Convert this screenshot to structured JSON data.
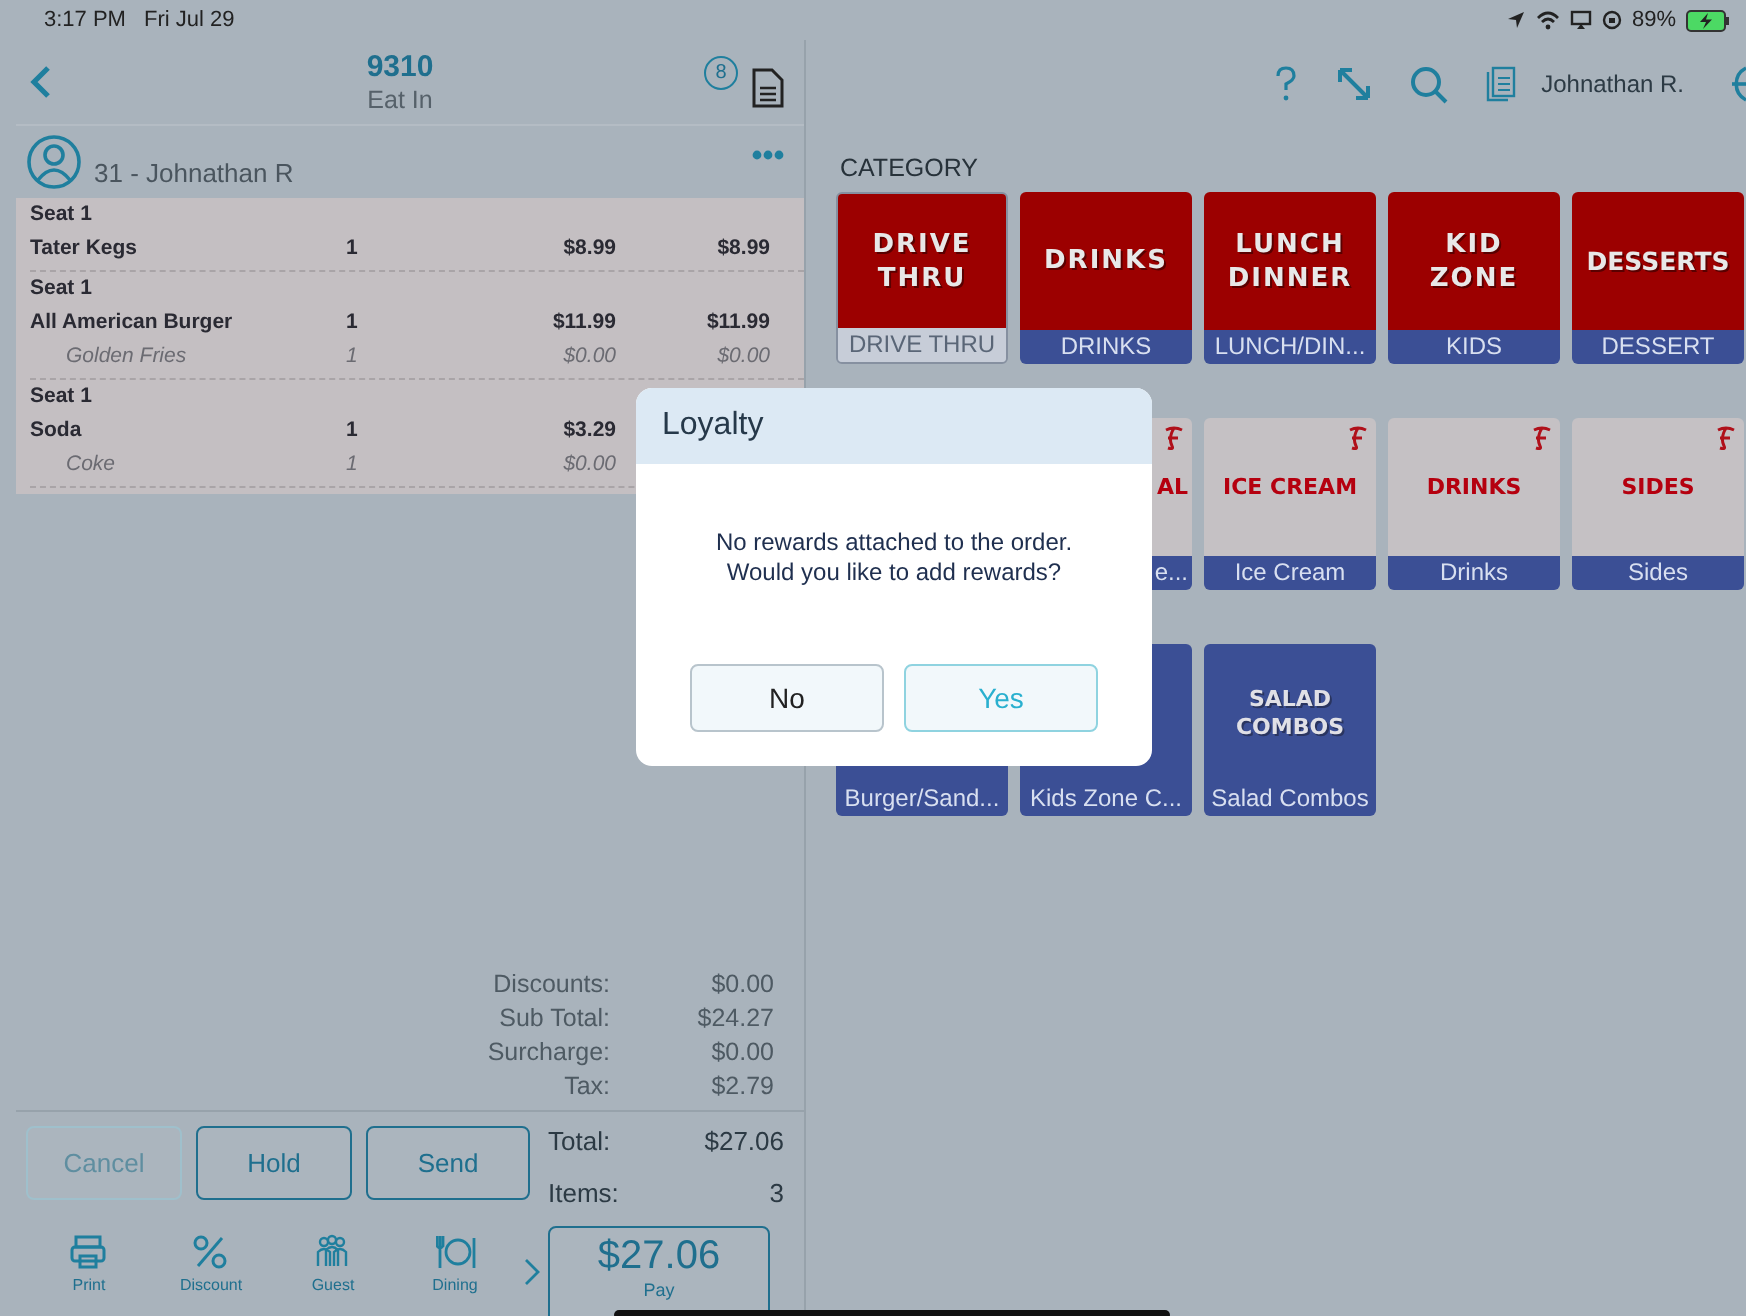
{
  "status_bar": {
    "time": "3:17 PM",
    "date": "Fri Jul 29",
    "battery": "89%"
  },
  "order_panel": {
    "number": "9310",
    "dining": "Eat In",
    "badge": "8",
    "customer": "31 - Johnathan R",
    "items": [
      {
        "seat": "Seat 1",
        "name": "Tater Kegs",
        "qty": "1",
        "price": "$8.99",
        "total": "$8.99"
      },
      {
        "seat": "Seat 1",
        "name": "All American Burger",
        "qty": "1",
        "price": "$11.99",
        "total": "$11.99",
        "modifiers": [
          {
            "name": "Golden Fries",
            "qty": "1",
            "price": "$0.00",
            "total": "$0.00"
          }
        ]
      },
      {
        "seat": "Seat 1",
        "name": "Soda",
        "qty": "1",
        "price": "$3.29",
        "modifiers": [
          {
            "name": "Coke",
            "qty": "1",
            "price": "$0.00"
          }
        ]
      }
    ],
    "totals": [
      {
        "label": "Discounts:",
        "value": "$0.00"
      },
      {
        "label": "Sub Total:",
        "value": "$24.27"
      },
      {
        "label": "Surcharge:",
        "value": "$0.00"
      },
      {
        "label": "Tax:",
        "value": "$2.79"
      }
    ],
    "buttons": [
      {
        "label": "Cancel",
        "disabled": true
      },
      {
        "label": "Hold",
        "disabled": false
      },
      {
        "label": "Send",
        "disabled": false
      }
    ],
    "summary": [
      {
        "label": "Total:",
        "value": "$27.06"
      },
      {
        "label": "Items:",
        "value": "3"
      }
    ],
    "toolbar": [
      {
        "kind": "print",
        "label": "Print"
      },
      {
        "kind": "percent",
        "label": "Discount"
      },
      {
        "kind": "people",
        "label": "Guest"
      },
      {
        "kind": "dining",
        "label": "Dining"
      }
    ],
    "pay": {
      "amount": "$27.06",
      "label": "Pay"
    }
  },
  "menu": {
    "user": "Johnathan R.",
    "category_heading": "CATEGORY",
    "categories": [
      {
        "title": [
          "DRIVE",
          "THRU"
        ],
        "label": "DRIVE THRU",
        "selected": true
      },
      {
        "title": [
          "DRINKS"
        ],
        "label": "DRINKS",
        "selected": false
      },
      {
        "title": [
          "LUNCH",
          "DINNER"
        ],
        "label": "LUNCH/DIN...",
        "selected": false
      },
      {
        "title": [
          "KID",
          "ZONE"
        ],
        "label": "KIDS",
        "selected": false
      },
      {
        "title": [
          "DESSERTS"
        ],
        "label": "DESSERT",
        "selected": false
      }
    ],
    "sub_rows": [
      [
        {
          "kind": "grey",
          "title": "AL",
          "label": "e...",
          "partial": true
        },
        {
          "kind": "grey",
          "title": "ICE CREAM",
          "label": "Ice Cream"
        },
        {
          "kind": "grey",
          "title": "DRINKS",
          "label": "Drinks"
        },
        {
          "kind": "grey",
          "title": "SIDES",
          "label": "Sides"
        }
      ],
      [
        {
          "kind": "blue",
          "label": "Burger/Sand..."
        },
        {
          "kind": "blue",
          "label": "Kids Zone C..."
        },
        {
          "kind": "blue",
          "title": "SALAD COMBOS",
          "label": "Salad Combos"
        }
      ]
    ]
  },
  "dialog": {
    "title": "Loyalty",
    "message": [
      "No rewards attached to the order.",
      "Would you like to add rewards?"
    ],
    "buttons": [
      {
        "label": "No",
        "primary": false
      },
      {
        "label": "Yes",
        "primary": true
      }
    ]
  }
}
